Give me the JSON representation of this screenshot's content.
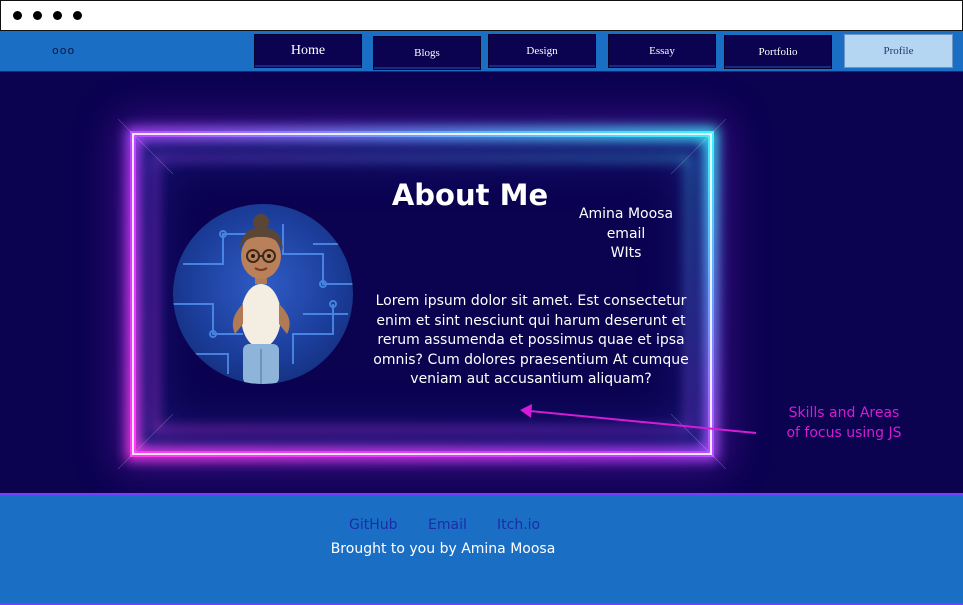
{
  "nav": {
    "menu_icon": "ooo",
    "tabs": [
      {
        "label": "Home"
      },
      {
        "label": "Blogs"
      },
      {
        "label": "Design"
      },
      {
        "label": "Essay"
      },
      {
        "label": "Portfolio"
      },
      {
        "label": "Profile"
      }
    ]
  },
  "about": {
    "title": "About Me",
    "name": "Amina Moosa",
    "email": "email",
    "org": "WIts",
    "bio": "Lorem ipsum dolor sit amet. Est consectetur enim et sint nesciunt qui harum deserunt et rerum assumenda et possimus quae et ipsa omnis? Cum dolores praesentium At cumque veniam aut accusantium aliquam?",
    "avatar_icon": "avatar-character-icon"
  },
  "annotation": {
    "text": "Skills and Areas of focus using JS"
  },
  "footer": {
    "links": [
      "GitHub",
      "Email",
      "Itch.io"
    ],
    "credit": "Brought to you by Amina Moosa"
  },
  "colors": {
    "background": "#0b0250",
    "nav": "#1a6fc4",
    "neon_pink": "#ff3cf2",
    "neon_cyan": "#3cf2ff",
    "annotation": "#d61bd6"
  }
}
